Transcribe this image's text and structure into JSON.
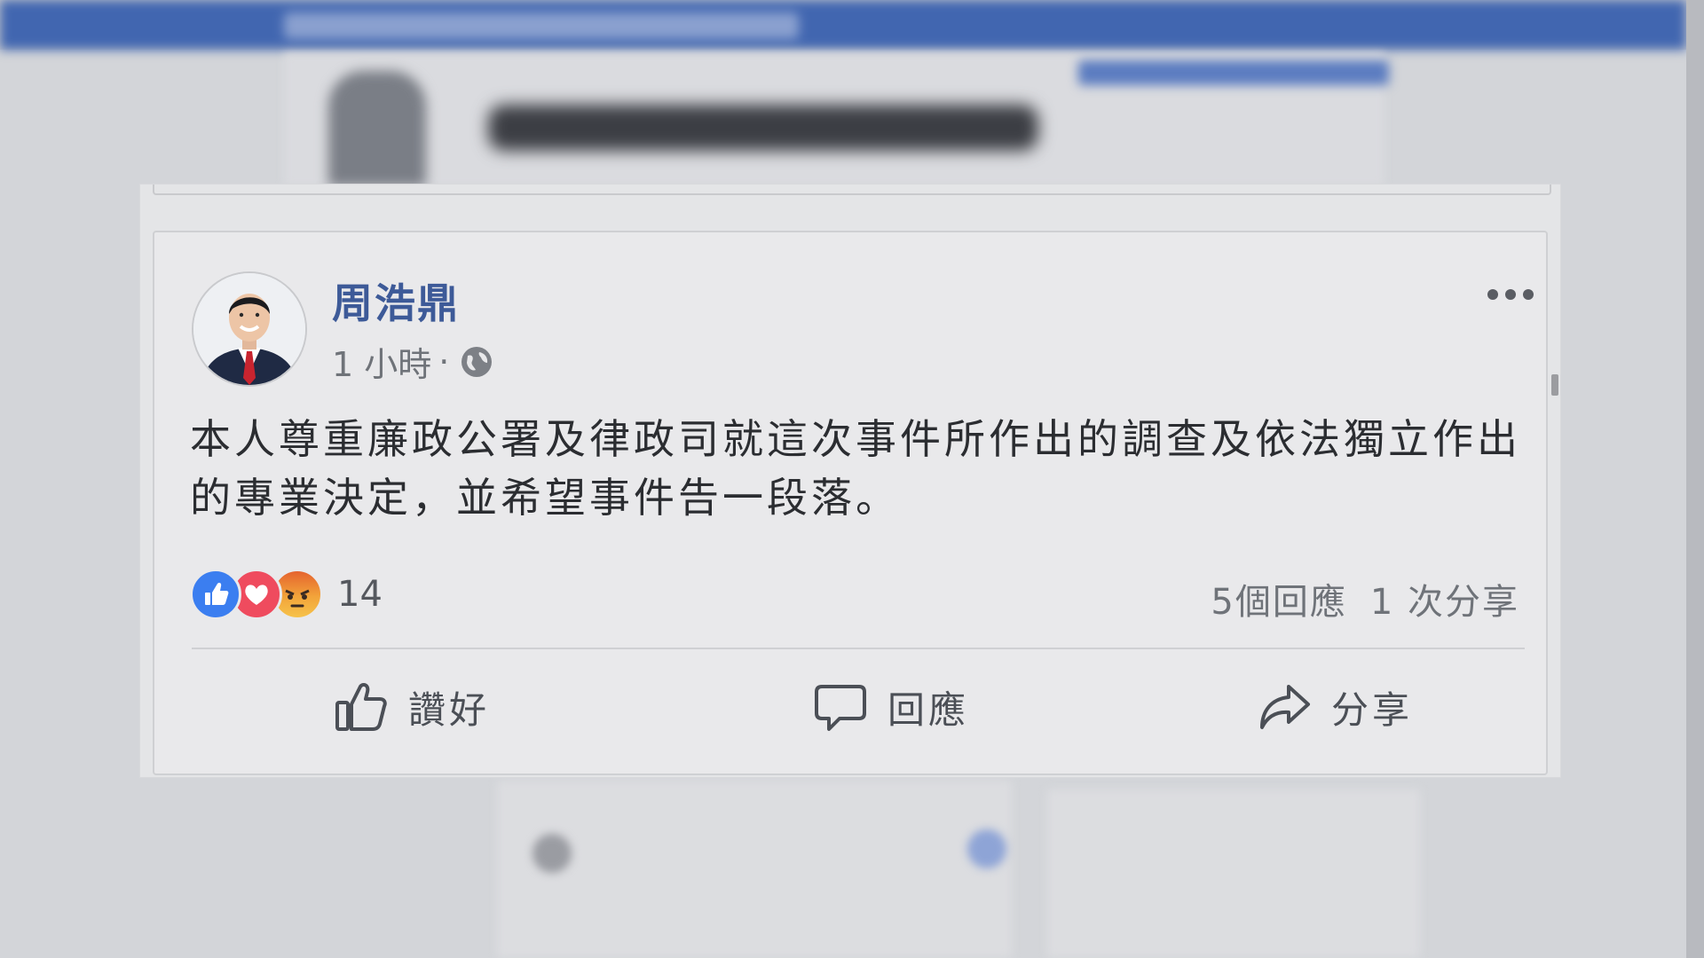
{
  "post": {
    "author": "周浩鼎",
    "time": "1 小時",
    "separator": "·",
    "text": "本人尊重廉政公署及律政司就這次事件所作出的調查及依法獨立作出的專業決定，並希望事件告一段落。",
    "reactions": {
      "types": [
        "like-icon",
        "love-icon",
        "angry-icon"
      ],
      "count": "14"
    },
    "comments": "5個回應",
    "shares": "1 次分享",
    "actions": {
      "like": "讚好",
      "comment": "回應",
      "share": "分享"
    }
  },
  "colors": {
    "author_name": "#3d5a98",
    "like_reaction": "#3b7ef0",
    "love_reaction": "#ef4b5e",
    "angry_reaction": "#e5632e",
    "topbar": "#4166b0"
  }
}
